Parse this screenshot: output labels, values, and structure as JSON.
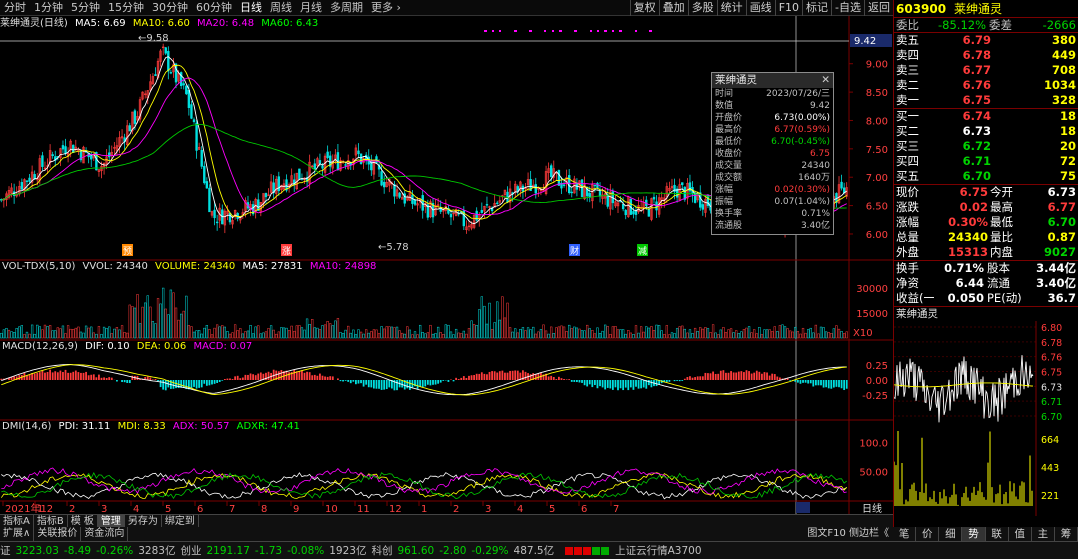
{
  "period_tabs": [
    "分时",
    "1分钟",
    "5分钟",
    "15分钟",
    "30分钟",
    "60分钟",
    "日线",
    "周线",
    "月线",
    "多周期",
    "更多 ›"
  ],
  "active_period": "日线",
  "right_buttons": [
    "复权",
    "叠加",
    "多股",
    "统计",
    "画线",
    "F10",
    "标记",
    "-自选",
    "返回"
  ],
  "main_indicator": {
    "name": "莱绅通灵(日线)",
    "ma5": "MA5: 6.69",
    "ma10": "MA10: 6.60",
    "ma20": "MA20: 6.48",
    "ma60": "MA60: 6.43"
  },
  "price_axis": [
    "9.00",
    "8.50",
    "8.00",
    "7.50",
    "7.00",
    "6.50",
    "6.00"
  ],
  "price_tag": "9.42",
  "high_label": "9.58",
  "low_label": "5.78",
  "event_marks": [
    "预",
    "涨",
    "财",
    "减"
  ],
  "vol_indicator": {
    "name": "VOL-TDX(5,10)",
    "vvol": "VVOL: 24340",
    "volume": "VOLUME: 24340",
    "ma5": "MA5: 27831",
    "ma10": "MA10: 24898"
  },
  "vol_axis": [
    "30000",
    "15000"
  ],
  "vol_unit": "X10",
  "macd_indicator": {
    "name": "MACD(12,26,9)",
    "dif": "DIF: 0.10",
    "dea": "DEA: 0.06",
    "macd": "MACD: 0.07"
  },
  "macd_axis": [
    "0.25",
    "0.00",
    "-0.25"
  ],
  "dmi_indicator": {
    "name": "DMI(14,6)",
    "pdi": "PDI: 31.11",
    "mdi": "MDI: 8.33",
    "adx": "ADX: 50.57",
    "adxr": "ADXR: 47.41"
  },
  "dmi_axis": [
    "100.0",
    "50.00"
  ],
  "date_axis": [
    "2021年12",
    "1",
    "2",
    "3",
    "4",
    "5",
    "6",
    "7",
    "8",
    "9",
    "10",
    "11",
    "12",
    "1",
    "2",
    "3",
    "4",
    "5",
    "6",
    "7"
  ],
  "period_label": "日线",
  "popup": {
    "title": "莱绅通灵",
    "rows": [
      {
        "k": "时间",
        "v": "2023/07/26/三",
        "c": "gry"
      },
      {
        "k": "数值",
        "v": "9.42",
        "c": "gry"
      },
      {
        "k": "开盘价",
        "v": "6.73(0.00%)",
        "c": "wht"
      },
      {
        "k": "最高价",
        "v": "6.77(0.59%)",
        "c": "red"
      },
      {
        "k": "最低价",
        "v": "6.70(-0.45%)",
        "c": "grn"
      },
      {
        "k": "收盘价",
        "v": "6.75",
        "c": "red"
      },
      {
        "k": "成交量",
        "v": "24340",
        "c": "gry"
      },
      {
        "k": "成交额",
        "v": "1640万",
        "c": "gry"
      },
      {
        "k": "涨幅",
        "v": "0.02(0.30%)",
        "c": "red"
      },
      {
        "k": "振幅",
        "v": "0.07(1.04%)",
        "c": "gry"
      },
      {
        "k": "换手率",
        "v": "0.71%",
        "c": "gry"
      },
      {
        "k": "流通股",
        "v": "3.40亿",
        "c": "gry"
      }
    ]
  },
  "quote": {
    "code": "603900",
    "name": "莱绅通灵",
    "weibi_label": "委比",
    "weibi": "-85.12%",
    "weicha_label": "委差",
    "weicha": "-2666",
    "asks": [
      {
        "label": "卖五",
        "price": "6.79",
        "vol": "380"
      },
      {
        "label": "卖四",
        "price": "6.78",
        "vol": "449"
      },
      {
        "label": "卖三",
        "price": "6.77",
        "vol": "708"
      },
      {
        "label": "卖二",
        "price": "6.76",
        "vol": "1034"
      },
      {
        "label": "卖一",
        "price": "6.75",
        "vol": "328"
      }
    ],
    "bids": [
      {
        "label": "买一",
        "price": "6.74",
        "vol": "18",
        "c": "red"
      },
      {
        "label": "买二",
        "price": "6.73",
        "vol": "18",
        "c": "wht"
      },
      {
        "label": "买三",
        "price": "6.72",
        "vol": "20",
        "c": "grn"
      },
      {
        "label": "买四",
        "price": "6.71",
        "vol": "72",
        "c": "grn"
      },
      {
        "label": "买五",
        "price": "6.70",
        "vol": "75",
        "c": "grn"
      }
    ],
    "stats": [
      {
        "l1": "现价",
        "v1": "6.75",
        "c1": "red",
        "l2": "今开",
        "v2": "6.73",
        "c2": "wht"
      },
      {
        "l1": "涨跌",
        "v1": "0.02",
        "c1": "red",
        "l2": "最高",
        "v2": "6.77",
        "c2": "red"
      },
      {
        "l1": "涨幅",
        "v1": "0.30%",
        "c1": "red",
        "l2": "最低",
        "v2": "6.70",
        "c2": "grn"
      },
      {
        "l1": "总量",
        "v1": "24340",
        "c1": "yel",
        "l2": "量比",
        "v2": "0.87",
        "c2": "yel"
      },
      {
        "l1": "外盘",
        "v1": "15313",
        "c1": "red",
        "l2": "内盘",
        "v2": "9027",
        "c2": "grn"
      }
    ],
    "stats2": [
      {
        "l1": "换手",
        "v1": "0.71%",
        "l2": "股本",
        "v2": "3.44亿"
      },
      {
        "l1": "净资",
        "v1": "6.44",
        "l2": "流通",
        "v2": "3.40亿"
      },
      {
        "l1": "收益(一)",
        "v1": "0.050",
        "l2": "PE(动)",
        "v2": "36.7"
      }
    ],
    "mini_title": "莱绅通灵",
    "mini_axis": [
      "6.80",
      "6.78",
      "6.76",
      "6.75",
      "6.73",
      "6.71",
      "6.70"
    ],
    "mini_vol_axis": [
      "664",
      "443",
      "221"
    ]
  },
  "bottom_tabs": [
    "指标A",
    "指标B",
    "模 板",
    "管理",
    "另存为",
    "绑定到"
  ],
  "active_bottom_tab": "管理",
  "bottom_tabs2": [
    "扩展∧",
    "关联报价",
    "资金流向"
  ],
  "bottom_right": "图文F10 侧边栏《",
  "quote_tabs": [
    "笔",
    "价",
    "细",
    "势",
    "联",
    "值",
    "主",
    "筹"
  ],
  "active_quote_tab": "势",
  "status": {
    "sh_label": "证",
    "sh": "3223.03",
    "sh_chg": "-8.49",
    "sh_pct": "-0.26%",
    "sh_amt": "3283亿",
    "cy_label": "创业",
    "cy": "2191.17",
    "cy_chg": "-1.73",
    "cy_pct": "-0.08%",
    "cy_amt": "1923亿",
    "kc_label": "科创",
    "kc": "961.60",
    "kc_chg": "-2.80",
    "kc_pct": "-0.29%",
    "kc_amt": "487.5亿",
    "server": "上证云行情A3700"
  }
}
